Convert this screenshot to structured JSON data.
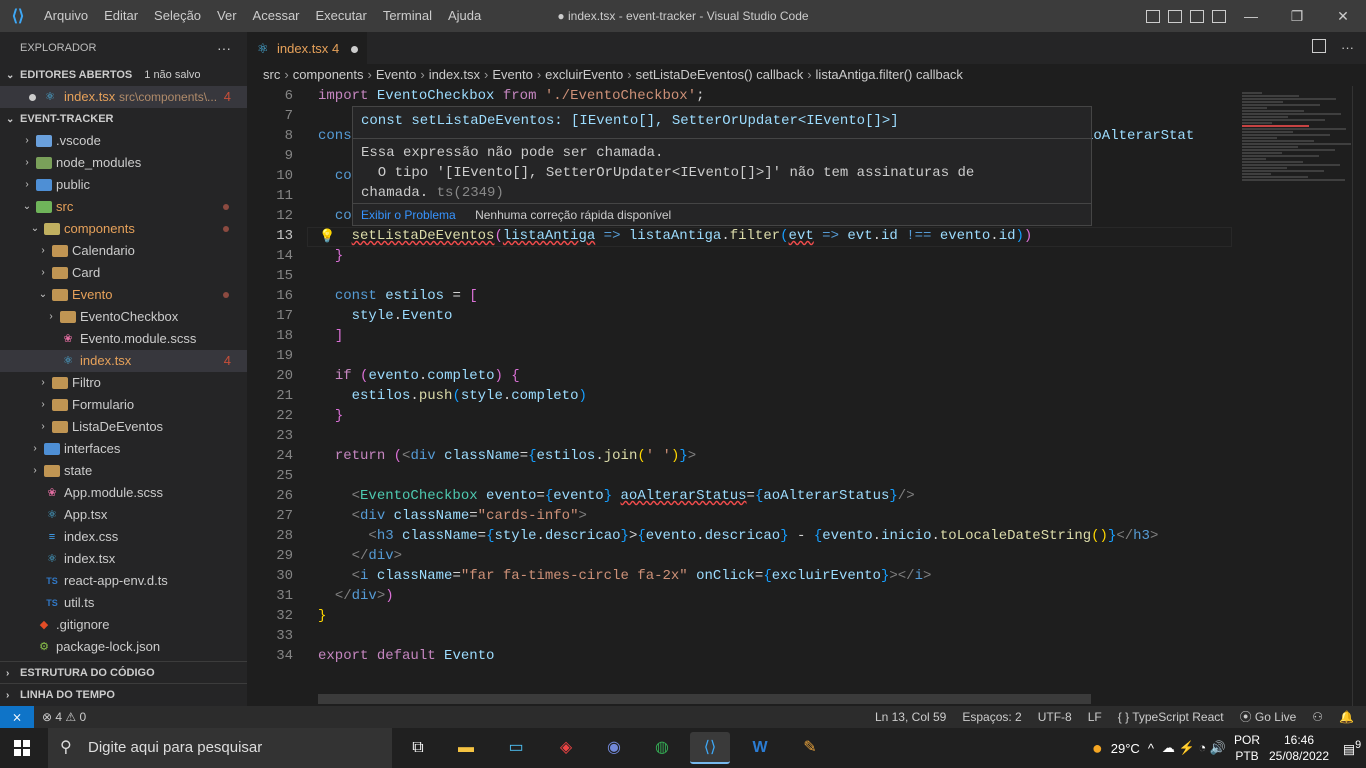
{
  "titlebar": {
    "logo": "vscode-logo",
    "menu": [
      "Arquivo",
      "Editar",
      "Seleção",
      "Ver",
      "Acessar",
      "Executar",
      "Terminal",
      "Ajuda"
    ],
    "title": "● index.tsx - event-tracker - Visual Studio Code",
    "controls": [
      "—",
      "❐",
      "✕"
    ]
  },
  "sidebar": {
    "header": "EXPLORADOR",
    "more": "···",
    "open_editors": {
      "label": "EDITORES ABERTOS",
      "note": "1 não salvo"
    },
    "open_file": {
      "name": "index.tsx",
      "path": "src\\components\\...",
      "badge": "4"
    },
    "project": "EVENT-TRACKER",
    "tree": [
      {
        "label": ".vscode",
        "type": "folder",
        "depth": 1,
        "color": "#6aa0dc"
      },
      {
        "label": "node_modules",
        "type": "folder",
        "depth": 1,
        "color": "#7aa05a"
      },
      {
        "label": "public",
        "type": "folder",
        "depth": 1,
        "color": "#4e8fd5"
      },
      {
        "label": "src",
        "type": "folder-open",
        "depth": 1,
        "color": "#6fb45a",
        "mod": true,
        "orange": true
      },
      {
        "label": "components",
        "type": "folder-open",
        "depth": 2,
        "color": "#c0b060",
        "mod": true,
        "orange": true
      },
      {
        "label": "Calendario",
        "type": "folder",
        "depth": 3,
        "color": "#c09553"
      },
      {
        "label": "Card",
        "type": "folder",
        "depth": 3,
        "color": "#c09553"
      },
      {
        "label": "Evento",
        "type": "folder-open",
        "depth": 3,
        "color": "#c09553",
        "mod": true,
        "orange": true
      },
      {
        "label": "EventoCheckbox",
        "type": "folder",
        "depth": 4,
        "color": "#c09553"
      },
      {
        "label": "Evento.module.scss",
        "type": "scss",
        "depth": 4
      },
      {
        "label": "index.tsx",
        "type": "tsx",
        "depth": 4,
        "selected": true,
        "badge": "4",
        "orange": true
      },
      {
        "label": "Filtro",
        "type": "folder",
        "depth": 3,
        "color": "#c09553"
      },
      {
        "label": "Formulario",
        "type": "folder",
        "depth": 3,
        "color": "#c09553"
      },
      {
        "label": "ListaDeEventos",
        "type": "folder",
        "depth": 3,
        "color": "#c09553"
      },
      {
        "label": "interfaces",
        "type": "folder",
        "depth": 2,
        "color": "#4e8fd5"
      },
      {
        "label": "state",
        "type": "folder",
        "depth": 2,
        "color": "#c09553"
      },
      {
        "label": "App.module.scss",
        "type": "scss",
        "depth": 2
      },
      {
        "label": "App.tsx",
        "type": "tsx",
        "depth": 2
      },
      {
        "label": "index.css",
        "type": "css",
        "depth": 2
      },
      {
        "label": "index.tsx",
        "type": "tsx",
        "depth": 2
      },
      {
        "label": "react-app-env.d.ts",
        "type": "ts",
        "depth": 2
      },
      {
        "label": "util.ts",
        "type": "ts",
        "depth": 2
      },
      {
        "label": ".gitignore",
        "type": "git",
        "depth": 1
      },
      {
        "label": "package-lock.json",
        "type": "json",
        "depth": 1
      }
    ],
    "outline": "ESTRUTURA DO CÓDIGO",
    "timeline": "LINHA DO TEMPO"
  },
  "editor": {
    "tab": {
      "label": "index.tsx",
      "badge": "4"
    },
    "breadcrumbs": [
      "src",
      "components",
      "Evento",
      "index.tsx",
      "Evento",
      "excluirEvento",
      "setListaDeEventos() callback",
      "listaAntiga.filter() callback"
    ],
    "current_line": 13,
    "lines": [
      {
        "n": 6,
        "html": "<span class='k'>import</span> <span class='v'>EventoCheckbox</span> <span class='k'>from</span> <span class='s'>'./EventoCheckbox'</span>;"
      },
      {
        "n": 7,
        "html": ""
      },
      {
        "n": 8,
        "html": "<span class='kw'>cons</span>"
      },
      {
        "n": 9,
        "html": ""
      },
      {
        "n": 10,
        "html": "  <span class='kw'>co</span>"
      },
      {
        "n": 11,
        "html": ""
      },
      {
        "n": 12,
        "html": "  <span class='kw'>co</span>"
      },
      {
        "n": 13,
        "html": "    <span class='f err'>setListaDeEventos</span><span class='p2'>(</span><span class='v err'>listaAntiga</span> <span class='kw'>=&gt;</span> <span class='v'>listaAntiga</span>.<span class='f'>filter</span><span class='p3'>(</span><span class='v err'>evt</span> <span class='kw'>=&gt;</span> <span class='v'>evt</span>.<span class='v'>id</span> <span class='kw'>!==</span> <span class='v'>evento</span>.<span class='v'>id</span><span class='p3'>)</span><span class='p2'>)</span>"
      },
      {
        "n": 14,
        "html": "  <span class='p2'>}</span>"
      },
      {
        "n": 15,
        "html": ""
      },
      {
        "n": 16,
        "html": "  <span class='kw'>const</span> <span class='v'>estilos</span> = <span class='p2'>[</span>"
      },
      {
        "n": 17,
        "html": "    <span class='v'>style</span>.<span class='v'>Evento</span>"
      },
      {
        "n": 18,
        "html": "  <span class='p2'>]</span>"
      },
      {
        "n": 19,
        "html": ""
      },
      {
        "n": 20,
        "html": "  <span class='k'>if</span> <span class='p2'>(</span><span class='v'>evento</span>.<span class='v'>completo</span><span class='p2'>)</span> <span class='p2'>{</span>"
      },
      {
        "n": 21,
        "html": "    <span class='v'>estilos</span>.<span class='f'>push</span><span class='p3'>(</span><span class='v'>style</span>.<span class='v'>completo</span><span class='p3'>)</span>"
      },
      {
        "n": 22,
        "html": "  <span class='p2'>}</span>"
      },
      {
        "n": 23,
        "html": ""
      },
      {
        "n": 24,
        "html": "  <span class='k'>return</span> <span class='p2'>(</span><span class='gr'>&lt;</span><span class='tag'>div</span> <span class='v'>className</span>=<span class='p3'>{</span><span class='v'>estilos</span>.<span class='f'>join</span><span class='p'>(</span><span class='s'>' '</span><span class='p'>)</span><span class='p3'>}</span><span class='gr'>&gt;</span>"
      },
      {
        "n": 25,
        "html": ""
      },
      {
        "n": 26,
        "html": "    <span class='gr'>&lt;</span><span class='t'>EventoCheckbox</span> <span class='v'>evento</span>=<span class='p3'>{</span><span class='v'>evento</span><span class='p3'>}</span> <span class='v err'>aoAlterarStatus</span>=<span class='p3'>{</span><span class='v'>aoAlterarStatus</span><span class='p3'>}</span><span class='gr'>/&gt;</span>"
      },
      {
        "n": 27,
        "html": "    <span class='gr'>&lt;</span><span class='tag'>div</span> <span class='v'>className</span>=<span class='s'>\"cards-info\"</span><span class='gr'>&gt;</span>"
      },
      {
        "n": 28,
        "html": "      <span class='gr'>&lt;</span><span class='tag'>h3</span> <span class='v'>className</span>=<span class='p3'>{</span><span class='v'>style</span>.<span class='v'>descricao</span><span class='p3'>}</span>&gt;<span class='p3'>{</span><span class='v'>evento</span>.<span class='v'>descricao</span><span class='p3'>}</span> - <span class='p3'>{</span><span class='v'>evento</span>.<span class='v'>inicio</span>.<span class='f'>toLocaleDateString</span><span class='p'>()</span><span class='p3'>}</span><span class='gr'>&lt;/</span><span class='tag'>h3</span><span class='gr'>&gt;</span>"
      },
      {
        "n": 29,
        "html": "    <span class='gr'>&lt;/</span><span class='tag'>div</span><span class='gr'>&gt;</span>"
      },
      {
        "n": 30,
        "html": "    <span class='gr'>&lt;</span><span class='tag'>i</span> <span class='v'>className</span>=<span class='s'>\"far fa-times-circle fa-2x\"</span> <span class='v'>onClick</span>=<span class='p3'>{</span><span class='v'>excluirEvento</span><span class='p3'>}</span><span class='gr'>&gt;&lt;/</span><span class='tag'>i</span><span class='gr'>&gt;</span>"
      },
      {
        "n": 31,
        "html": "  <span class='gr'>&lt;/</span><span class='tag'>div</span><span class='gr'>&gt;</span><span class='p2'>)</span>"
      },
      {
        "n": 32,
        "html": "<span class='p'>}</span>"
      },
      {
        "n": 33,
        "html": ""
      },
      {
        "n": 34,
        "html": "<span class='k'>export</span> <span class='k'>default</span> <span class='v'>Evento</span>"
      }
    ],
    "line8_tail": "nto, aoAlterarStat",
    "hover": {
      "signature": "const setListaDeEventos: [IEvento[], SetterOrUpdater<IEvento[]>]",
      "message_1": "Essa expressão não pode ser chamada.",
      "message_2": "  O tipo '[IEvento[], SetterOrUpdater<IEvento[]>]' não tem assinaturas de",
      "message_3": "chamada.",
      "code": "ts(2349)",
      "action_link": "Exibir o Problema",
      "action_text": "Nenhuma correção rápida disponível"
    }
  },
  "statusbar": {
    "remote": "⨯",
    "problems": "⊗ 4 ⚠ 0",
    "position": "Ln 13, Col 59",
    "spaces": "Espaços: 2",
    "encoding": "UTF-8",
    "eol": "LF",
    "language": "{ } TypeScript React",
    "golive": "Go Live"
  },
  "taskbar": {
    "search_placeholder": "Digite aqui para pesquisar",
    "weather": "29°C",
    "lang1": "POR",
    "lang2": "PTB",
    "time": "16:46",
    "date": "25/08/2022",
    "notif": "9"
  }
}
